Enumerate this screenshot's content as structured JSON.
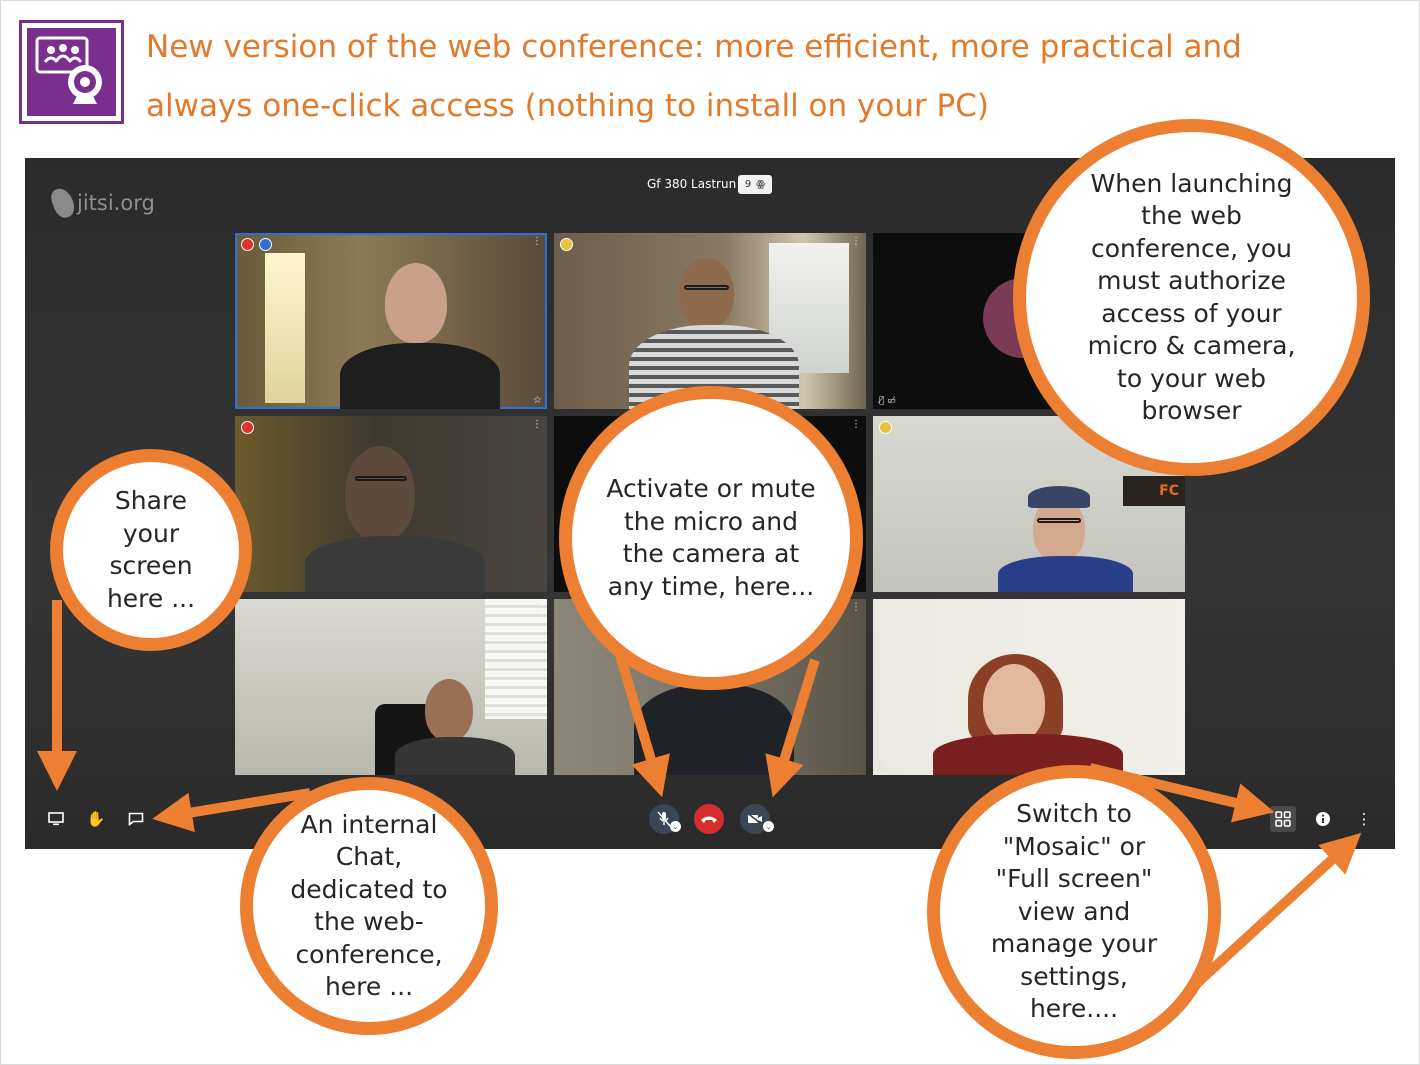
{
  "header": {
    "title_line1": "New version of the web conference: more efficient, more practical and",
    "title_line2": "always one-click access (nothing to install on your PC)",
    "logo_icon": "webcam-meeting-icon",
    "accent_color": "#e37a2b",
    "logo_color": "#7a2e8e"
  },
  "conference": {
    "brand": "jitsi.org",
    "room_name": "Gf 380 Lastrun",
    "participant_count": "9",
    "participants_icon": "participants-icon",
    "tiles": 9,
    "toolbar": {
      "left": [
        "screen-share-icon",
        "raise-hand-icon",
        "chat-icon"
      ],
      "center": [
        "microphone-muted-icon",
        "hangup-icon",
        "camera-off-icon"
      ],
      "right": [
        "tile-view-icon",
        "info-icon",
        "more-options-icon"
      ]
    }
  },
  "callouts": {
    "authorize": "When launching the web conference, you must authorize access of your micro & camera, to your web browser",
    "share": "Share your screen here ...",
    "mic_camera": "Activate or mute the micro and the camera at any time, here...",
    "chat": "An internal Chat, dedicated to the web-conference, here ...",
    "view": "Switch to \"Mosaic\" or \"Full screen\" view and manage your settings, here...."
  },
  "colors": {
    "callout_border": "#ec7f32",
    "active_tile": "#2f6fd8",
    "hangup": "#d62d2d"
  }
}
